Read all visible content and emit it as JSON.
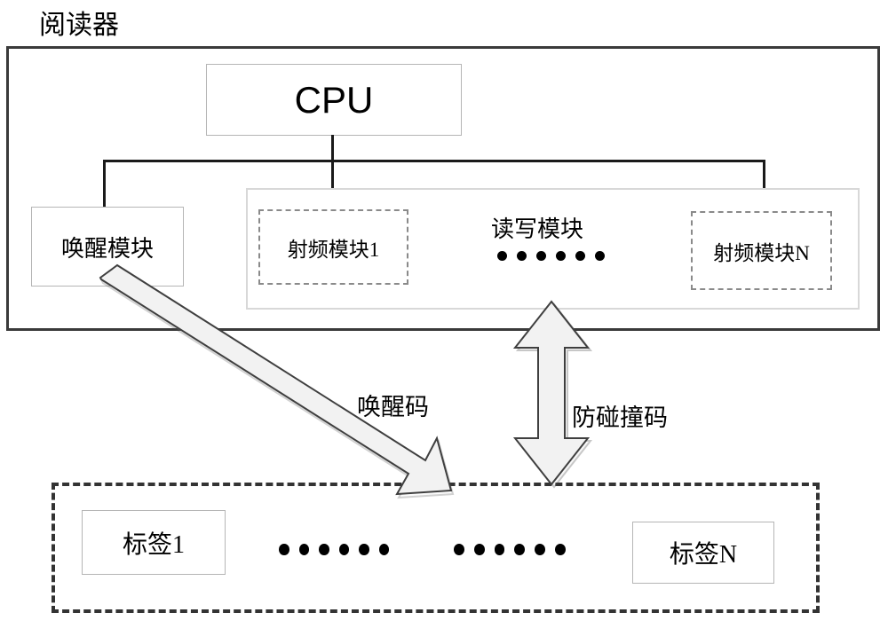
{
  "diagram": {
    "title": "阅读器",
    "reader": {
      "cpu": {
        "label": "CPU"
      },
      "wakeup_module": {
        "label": "唤醒模块"
      },
      "read_write_module": {
        "label": "读写模块",
        "ellipsis_dots": 6,
        "rf_modules": [
          {
            "label": "射频模块1"
          },
          {
            "label": "射频模块N"
          }
        ]
      }
    },
    "tags_group": {
      "tags": [
        {
          "label": "标签1"
        },
        {
          "label": "标签N"
        }
      ],
      "ellipsis_groups": [
        6,
        6
      ]
    },
    "signals": [
      {
        "name": "wake_code",
        "label": "唤醒码",
        "direction": "reader-to-tags"
      },
      {
        "name": "anticollision_code",
        "label": "防碰撞码",
        "direction": "bidirectional"
      }
    ],
    "colors": {
      "outline_dark": "#3a3a3a",
      "outline_light": "#b5b5b5",
      "dashed_gray": "#8a8a8a",
      "dashed_dark": "#333333",
      "wire": "#1a1a1a",
      "arrow_fill": "#efefef",
      "arrow_stroke": "#4a4a4a",
      "background": "#ffffff",
      "text": "#000000"
    }
  }
}
